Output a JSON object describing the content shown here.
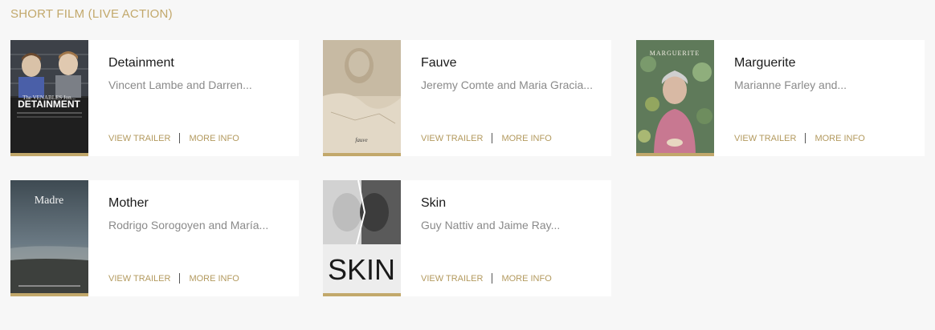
{
  "category": {
    "title": "SHORT FILM (LIVE ACTION)"
  },
  "films": [
    {
      "title": "Detainment",
      "nominees": "Vincent Lambe and Darren...",
      "trailer_label": "VIEW TRAILER",
      "info_label": "MORE INFO",
      "poster_text": "DETAINMENT",
      "poster_subtext": "The VENABLES Jon..."
    },
    {
      "title": "Fauve",
      "nominees": "Jeremy Comte and Maria Gracia...",
      "trailer_label": "VIEW TRAILER",
      "info_label": "MORE INFO",
      "poster_text": "fauve"
    },
    {
      "title": "Marguerite",
      "nominees": "Marianne Farley and...",
      "trailer_label": "VIEW TRAILER",
      "info_label": "MORE INFO",
      "poster_text": "MARGUERITE"
    },
    {
      "title": "Mother",
      "nominees": "Rodrigo Sorogoyen and María...",
      "trailer_label": "VIEW TRAILER",
      "info_label": "MORE INFO",
      "poster_text": "Madre"
    },
    {
      "title": "Skin",
      "nominees": "Guy Nattiv and Jaime Ray...",
      "trailer_label": "VIEW TRAILER",
      "info_label": "MORE INFO",
      "poster_text": "SKIN"
    }
  ],
  "colors": {
    "accent": "#c2a86b",
    "link": "#b39a5f",
    "background": "#f7f7f7"
  }
}
